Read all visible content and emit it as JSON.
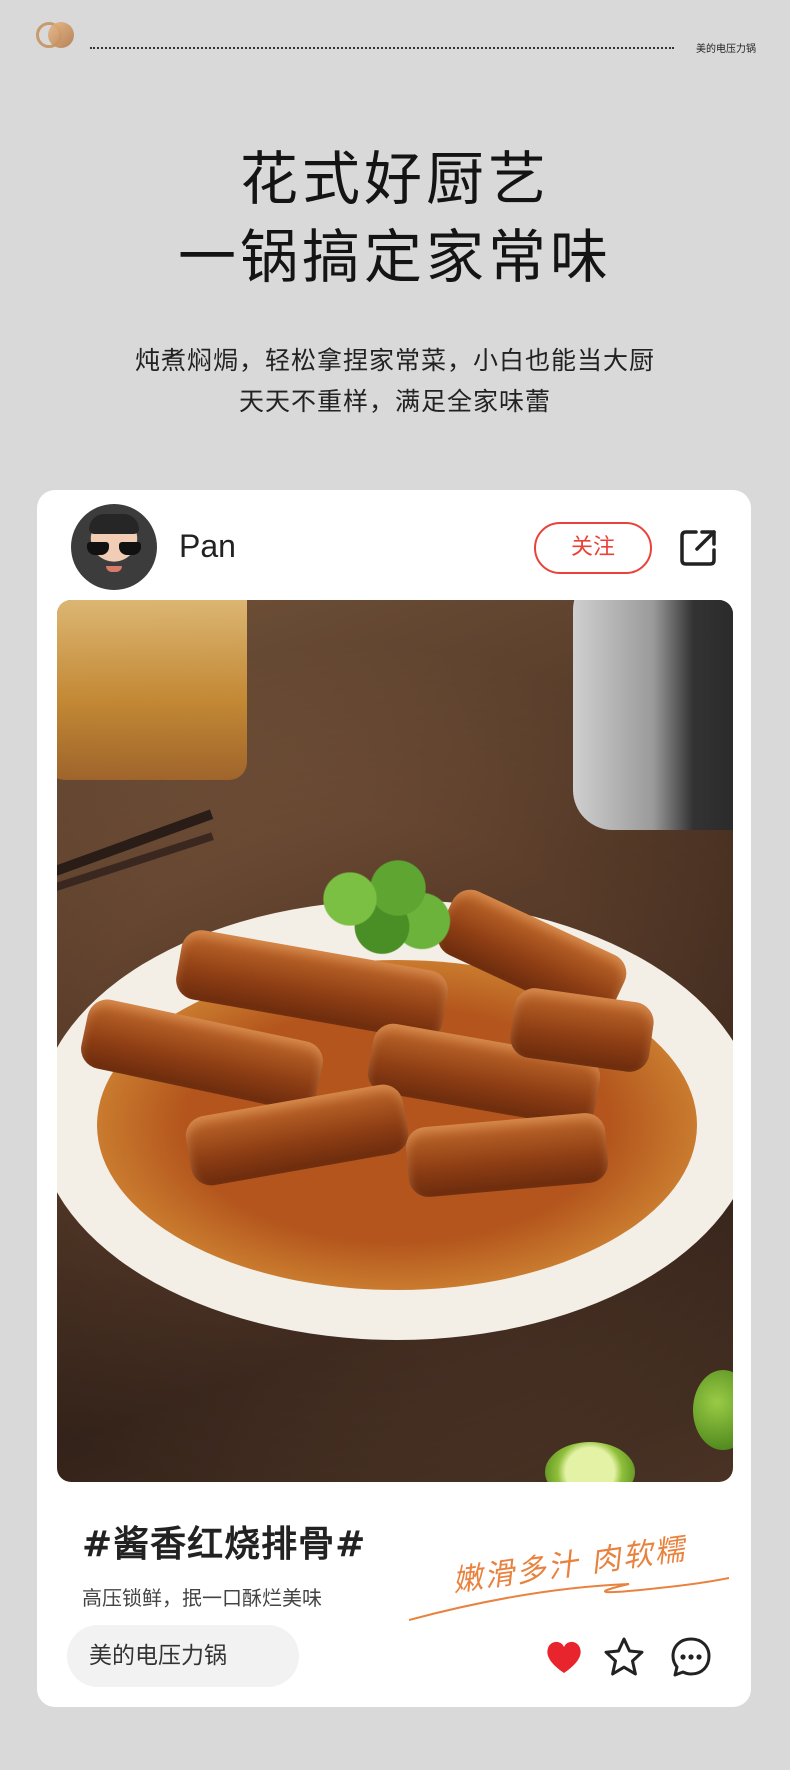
{
  "header": {
    "brand_small": "美的电压力锅"
  },
  "headline": {
    "line1": "花式好厨艺",
    "line2": "一锅搞定家常味"
  },
  "subheadline": {
    "line1": "炖煮焖焗，轻松拿捏家常菜，小白也能当大厨",
    "line2": "天天不重样，满足全家味蕾"
  },
  "post": {
    "username": "Pan",
    "follow_label": "关注",
    "hashtag": "#酱香红烧排骨#",
    "description": "高压锁鲜，抿一口酥烂美味",
    "slogan": "嫩滑多汁 肉软糯",
    "brand_tag": "美的电压力锅",
    "icons": [
      "share-icon",
      "heart-icon",
      "star-icon",
      "comment-icon"
    ]
  },
  "colors": {
    "background": "#d9d9d9",
    "accent_red": "#e8423a",
    "slogan_orange": "#e9823e",
    "card": "#ffffff"
  }
}
